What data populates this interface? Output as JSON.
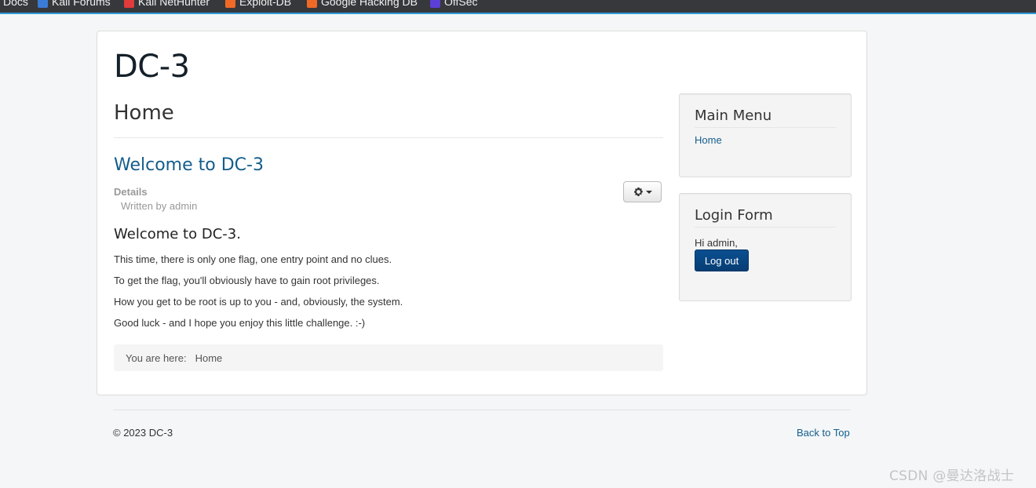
{
  "bookmarks_bar": {
    "items": [
      {
        "label": "Docs",
        "icon": "docs-icon"
      },
      {
        "label": "Kali Forums",
        "icon": "kali-forums-icon"
      },
      {
        "label": "Kali NetHunter",
        "icon": "kali-nethunter-icon"
      },
      {
        "label": "Exploit-DB",
        "icon": "exploit-db-icon"
      },
      {
        "label": "Google Hacking DB",
        "icon": "google-hacking-db-icon"
      },
      {
        "label": "OffSec",
        "icon": "offsec-icon"
      }
    ],
    "accent_color": "#2f97d7"
  },
  "site": {
    "brand": "DC-3"
  },
  "main": {
    "page_title": "Home",
    "article": {
      "title": "Welcome to DC-3",
      "details_label": "Details",
      "written_by": "Written by admin",
      "body_heading": "Welcome to DC-3.",
      "paragraphs": [
        "This time, there is only one flag, one entry point and no clues.",
        "To get the flag, you'll obviously have to gain root privileges.",
        "How you get to be root is up to you - and, obviously, the system.",
        "Good luck - and I hope you enjoy this little challenge.  :-)"
      ],
      "tools_icon": "gear-icon"
    },
    "breadcrumb": {
      "label": "You are here:",
      "current": "Home"
    }
  },
  "sidebar": {
    "main_menu": {
      "title": "Main Menu",
      "items": [
        "Home"
      ]
    },
    "login_form": {
      "title": "Login Form",
      "greeting": "Hi admin,",
      "logout_label": "Log out",
      "button_color": "#0a4f91"
    }
  },
  "footer": {
    "copyright": "© 2023 DC-3",
    "back_to_top": "Back to Top"
  },
  "watermark": "CSDN @曼达洛战士",
  "colors": {
    "link": "#135d8c",
    "background": "#f4f6f7"
  }
}
